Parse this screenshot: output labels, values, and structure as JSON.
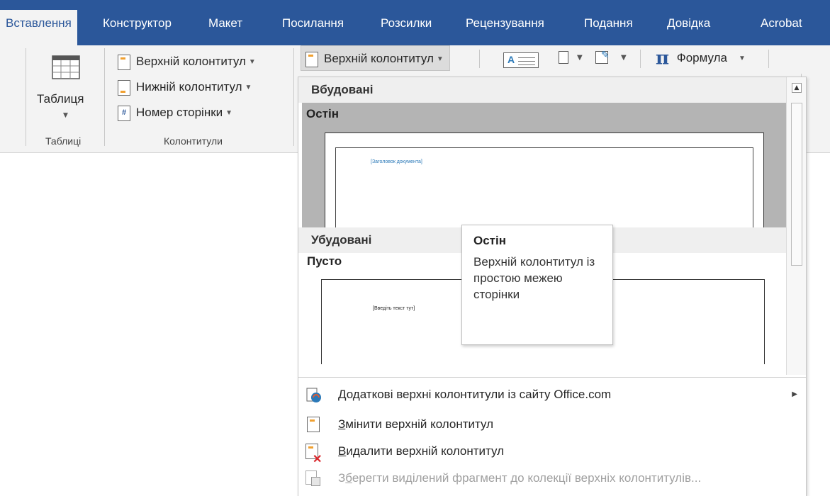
{
  "tabs": [
    {
      "label": "Вставлення",
      "active": true
    },
    {
      "label": "Конструктор"
    },
    {
      "label": "Макет"
    },
    {
      "label": "Посилання"
    },
    {
      "label": "Розсилки"
    },
    {
      "label": "Рецензування"
    },
    {
      "label": "Подання"
    },
    {
      "label": "Довідка"
    },
    {
      "label": "Acrobat"
    }
  ],
  "ribbon": {
    "table_button": "Таблиця",
    "tables_group": "Таблиці",
    "header_item": "Верхній колонтитул",
    "footer_item": "Нижній колонтитул",
    "page_number_item": "Номер сторінки",
    "headers_group": "Колонтитули",
    "header_dropdown": "Верхній колонтитул",
    "formula": "Формула",
    "pi_symbol": "π"
  },
  "gallery": {
    "section_builtin": "Вбудовані",
    "selected_title": "Остін",
    "selected_placeholder": "[Заголовок документа]",
    "section_builtin2": "Убудовані",
    "blank_title": "Пусто",
    "blank_placeholder": "[Введіть текст тут]"
  },
  "tooltip": {
    "title": "Остін",
    "body": "Верхній колонтитул із простою межею сторінки"
  },
  "menu": {
    "more_headers_prefix": "Д",
    "more_headers_rest": "одаткові верхні колонтитули із сайту Office.com",
    "edit_prefix": "З",
    "edit_rest": "мінити верхній колонтитул",
    "remove_prefix": "В",
    "remove_rest": "идалити верхній колонтитул",
    "save_a": "З",
    "save_b": "б",
    "save_rest": "ерегти виділений фрагмент до колекції верхніх колонтитулів..."
  },
  "colors": {
    "tabbar": "#2b579a",
    "placeholder_blue": "#2b79b8"
  }
}
